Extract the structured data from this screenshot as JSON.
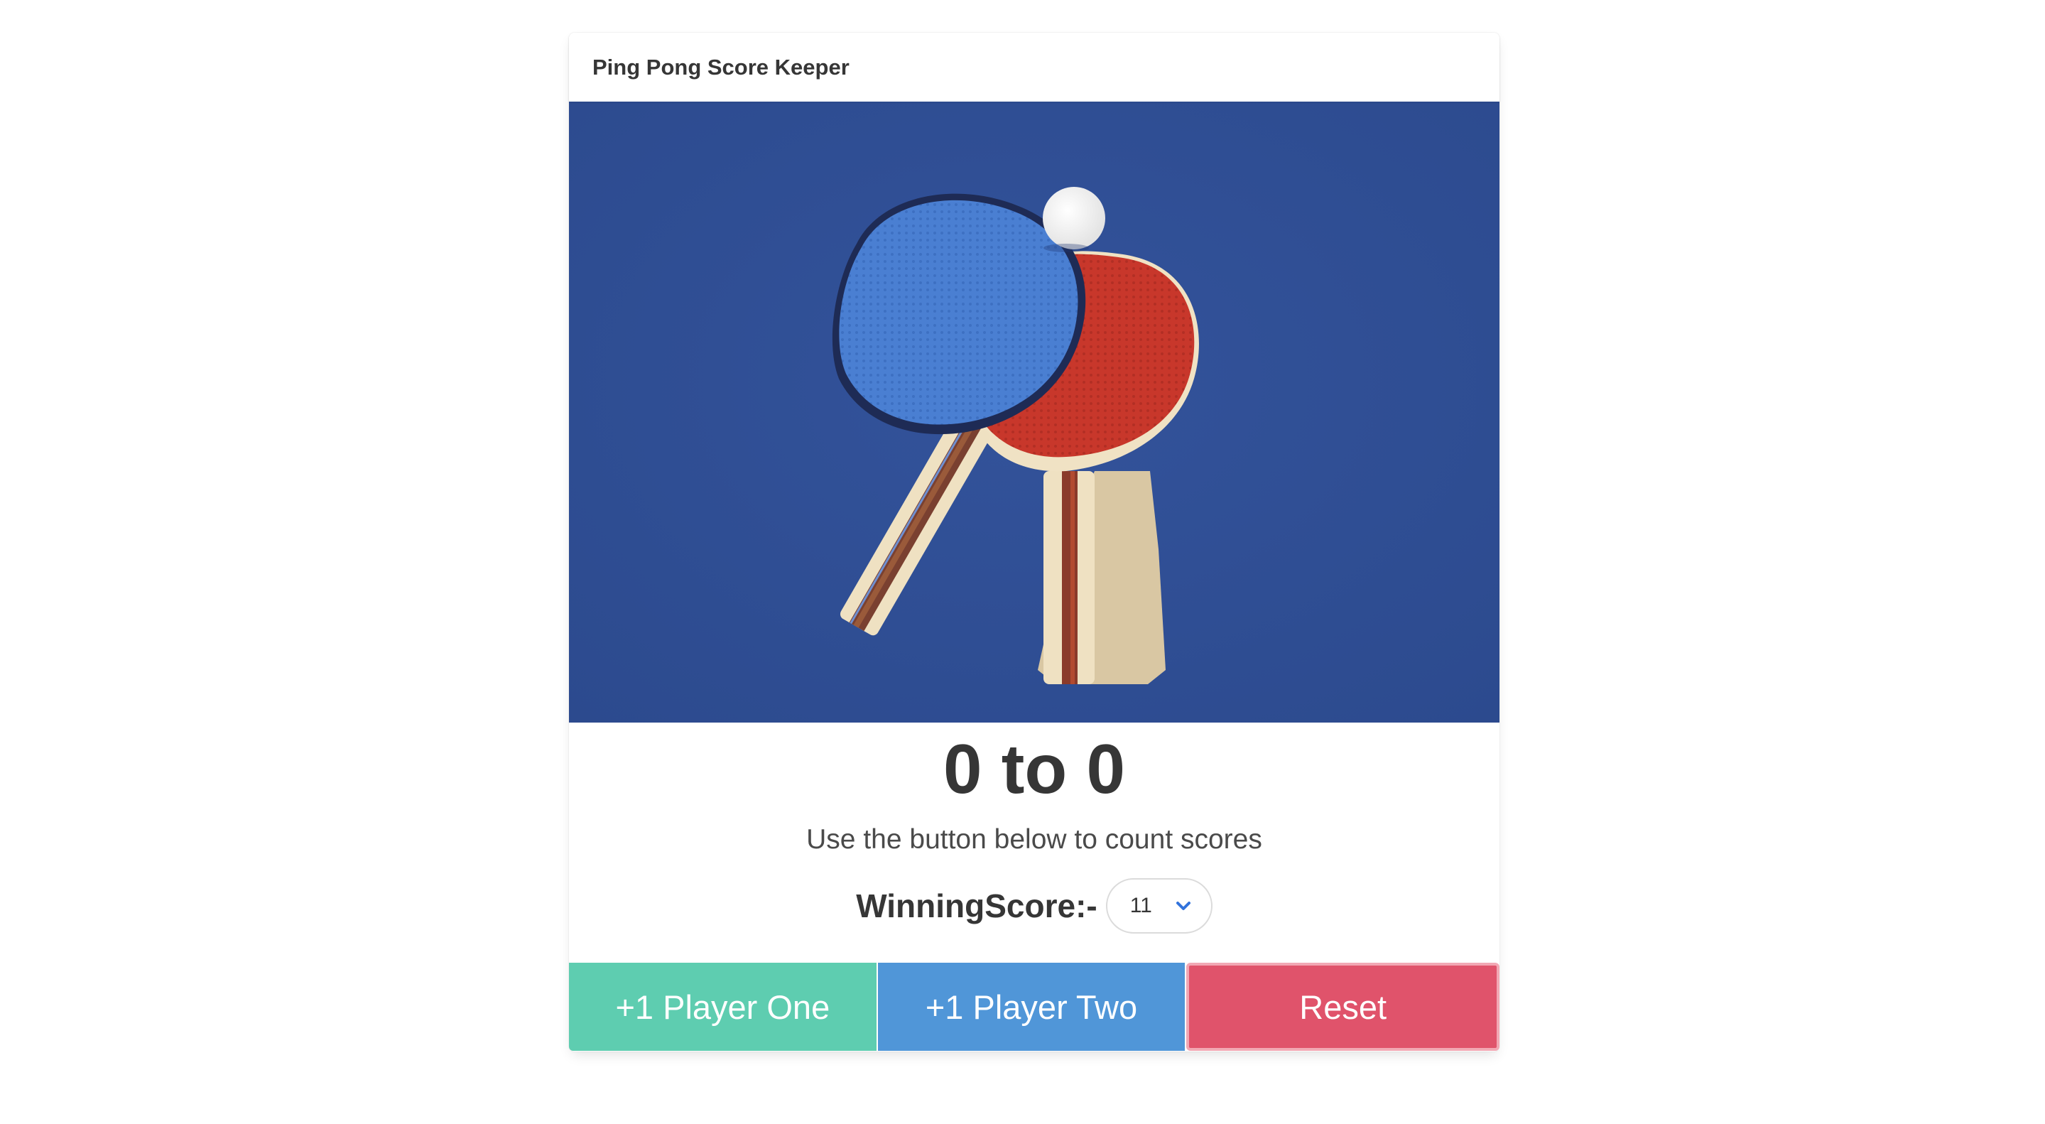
{
  "card": {
    "title": "Ping Pong Score Keeper"
  },
  "image": {
    "description_icon": "ping-pong-paddles-image"
  },
  "score": {
    "player_one": "0",
    "player_two": "0",
    "text": "0 to 0"
  },
  "subtitle": "Use the button below to count scores",
  "winning": {
    "label": "WinningScore:-",
    "selected": "11"
  },
  "buttons": {
    "player_one": "+1 Player One",
    "player_two": "+1 Player Two",
    "reset": "Reset"
  },
  "colors": {
    "player_one": "#5ecdb0",
    "player_two": "#5096d8",
    "reset": "#e0536b",
    "table_blue": "#2f4f96"
  }
}
